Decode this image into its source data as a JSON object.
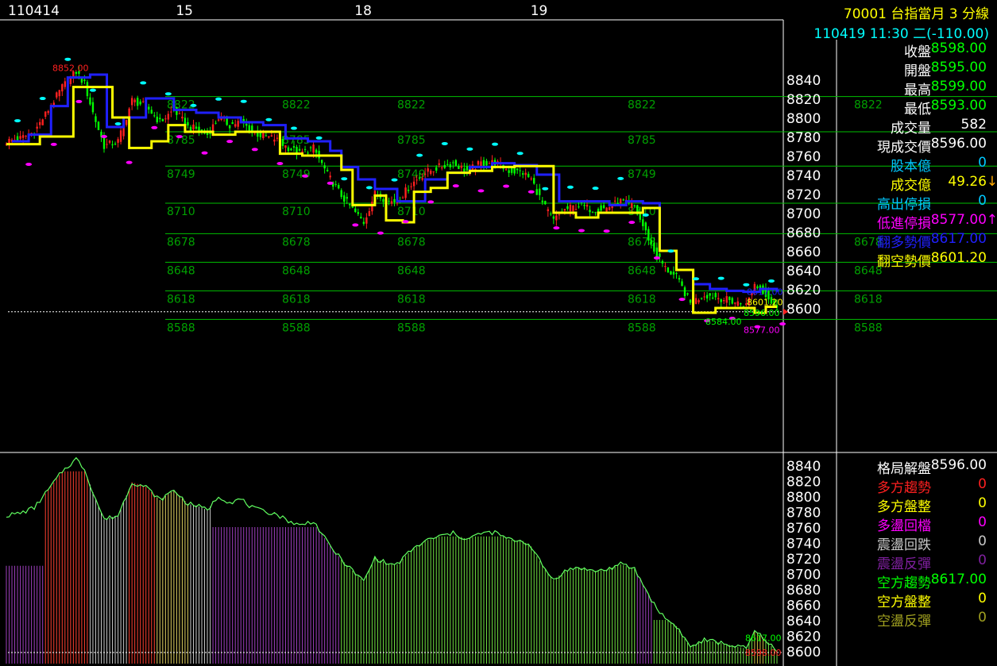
{
  "header": {
    "date_left": "110414",
    "day_labels": [
      "15",
      "18",
      "19"
    ],
    "title": "70001  台指當月 3 分線",
    "subtitle": "110419 11:30 二(-110.00)"
  },
  "quote_panel": [
    {
      "key": "close",
      "label": "收盤",
      "value": "8598.00",
      "label_color": "#ffffff",
      "value_color": "#00ff00"
    },
    {
      "key": "open",
      "label": "開盤",
      "value": "8595.00",
      "label_color": "#ffffff",
      "value_color": "#00ff00"
    },
    {
      "key": "high",
      "label": "最高",
      "value": "8599.00",
      "label_color": "#ffffff",
      "value_color": "#00ff00"
    },
    {
      "key": "low",
      "label": "最低",
      "value": "8593.00",
      "label_color": "#ffffff",
      "value_color": "#00ff00"
    },
    {
      "key": "volume",
      "label": "成交量",
      "value": "582",
      "label_color": "#ffffff",
      "value_color": "#ffffff"
    },
    {
      "key": "last",
      "label": "現成交價",
      "value": "8596.00",
      "label_color": "#ffffff",
      "value_color": "#ffffff"
    },
    {
      "key": "capital",
      "label": "股本億",
      "value": "0",
      "label_color": "#00c8ff",
      "value_color": "#00c8ff"
    },
    {
      "key": "turnover",
      "label": "成交億",
      "value": "49.26",
      "label_color": "#ffff00",
      "value_color": "#ffff00",
      "arrow": "↓",
      "arrow_color": "#ffaa00"
    },
    {
      "key": "high_stop",
      "label": "高出停損",
      "value": "0",
      "label_color": "#00c8ff",
      "value_color": "#00c8ff"
    },
    {
      "key": "low_stop",
      "label": "低進停損",
      "value": "8577.00",
      "label_color": "#ff00ff",
      "value_color": "#ff00ff",
      "arrow": "↑",
      "arrow_color": "#ff00ff"
    },
    {
      "key": "bull_price",
      "label": "翻多勢價",
      "value": "8617.00",
      "label_color": "#2020ff",
      "value_color": "#2020ff"
    },
    {
      "key": "bear_price",
      "label": "翻空勢價",
      "value": "8601.20",
      "label_color": "#ffff00",
      "value_color": "#ffff00"
    }
  ],
  "pattern_panel": [
    {
      "key": "solution",
      "label": "格局解盤",
      "value": "8596.00",
      "label_color": "#ffffff",
      "value_color": "#ffffff"
    },
    {
      "key": "bull_trend",
      "label": "多方趨勢",
      "value": "0",
      "label_color": "#ff2020",
      "value_color": "#ff2020"
    },
    {
      "key": "bull_range",
      "label": "多方盤整",
      "value": "0",
      "label_color": "#ffff00",
      "value_color": "#ffff00"
    },
    {
      "key": "bull_pull",
      "label": "多盪回檔",
      "value": "0",
      "label_color": "#ff00ff",
      "value_color": "#ff00ff"
    },
    {
      "key": "osc_fall",
      "label": "震盪回跌",
      "value": "0",
      "label_color": "#c8c8c8",
      "value_color": "#c8c8c8"
    },
    {
      "key": "osc_rebound",
      "label": "震盪反彈",
      "value": "0",
      "label_color": "#8020a0",
      "value_color": "#8020a0"
    },
    {
      "key": "bear_trend",
      "label": "空方趨勢",
      "value": "8617.00",
      "label_color": "#00ff00",
      "value_color": "#00ff00"
    },
    {
      "key": "bear_range",
      "label": "空方盤整",
      "value": "0",
      "label_color": "#ffff00",
      "value_color": "#ffff00"
    },
    {
      "key": "bear_rebound",
      "label": "空盪反彈",
      "value": "0",
      "label_color": "#a0a020",
      "value_color": "#a0a020"
    }
  ],
  "chart_data": [
    {
      "type": "candlestick",
      "name": "main",
      "y_ticks": [
        8840,
        8820,
        8800,
        8780,
        8760,
        8740,
        8720,
        8700,
        8680,
        8660,
        8640,
        8620,
        8600
      ],
      "ylim": [
        8560,
        8868
      ],
      "x_breaks": [
        "15",
        "18",
        "19"
      ],
      "levels": [
        {
          "value": 8822,
          "label": "8822"
        },
        {
          "value": 8785,
          "label": "8785"
        },
        {
          "value": 8749,
          "label": "8749"
        },
        {
          "value": 8710,
          "label": "8710"
        },
        {
          "value": 8678,
          "label": "8678"
        },
        {
          "value": 8648,
          "label": "8648"
        },
        {
          "value": 8618,
          "label": "8618"
        },
        {
          "value": 8588,
          "label": "8588"
        }
      ],
      "close_price_line": 8596,
      "annotations": [
        {
          "value": 8852,
          "label": "8852.00",
          "color": "#ff2020"
        },
        {
          "value": 8617,
          "label": "8617.00",
          "color": "#2020ff"
        },
        {
          "value": 8601.2,
          "label": "8601.20",
          "color": "#ffff00"
        },
        {
          "value": 8596,
          "label": "8596.00",
          "color": "#00ff00"
        },
        {
          "value": 8584,
          "label": "8584.00",
          "color": "#00ff00"
        },
        {
          "value": 8577,
          "label": "8577.00",
          "color": "#ff00ff"
        }
      ],
      "close_path": [
        [
          0,
          8775
        ],
        [
          5,
          8778
        ],
        [
          10,
          8785
        ],
        [
          15,
          8808
        ],
        [
          20,
          8832
        ],
        [
          25,
          8848
        ],
        [
          28,
          8835
        ],
        [
          31,
          8805
        ],
        [
          35,
          8770
        ],
        [
          40,
          8775
        ],
        [
          45,
          8818
        ],
        [
          50,
          8812
        ],
        [
          55,
          8795
        ],
        [
          60,
          8808
        ],
        [
          65,
          8790
        ],
        [
          68,
          8788
        ],
        [
          72,
          8782
        ],
        [
          76,
          8800
        ],
        [
          80,
          8792
        ],
        [
          84,
          8796
        ],
        [
          88,
          8785
        ],
        [
          92,
          8780
        ],
        [
          96,
          8778
        ],
        [
          100,
          8770
        ],
        [
          105,
          8762
        ],
        [
          110,
          8768
        ],
        [
          115,
          8740
        ],
        [
          120,
          8718
        ],
        [
          125,
          8700
        ],
        [
          128,
          8690
        ],
        [
          132,
          8720
        ],
        [
          137,
          8712
        ],
        [
          140,
          8712
        ],
        [
          145,
          8730
        ],
        [
          150,
          8742
        ],
        [
          155,
          8748
        ],
        [
          160,
          8752
        ],
        [
          165,
          8744
        ],
        [
          170,
          8752
        ],
        [
          175,
          8753
        ],
        [
          180,
          8744
        ],
        [
          185,
          8742
        ],
        [
          188,
          8735
        ],
        [
          192,
          8710
        ],
        [
          196,
          8692
        ],
        [
          200,
          8703
        ],
        [
          205,
          8708
        ],
        [
          210,
          8703
        ],
        [
          215,
          8705
        ],
        [
          220,
          8712
        ],
        [
          225,
          8706
        ],
        [
          228,
          8686
        ],
        [
          232,
          8660
        ],
        [
          236,
          8642
        ],
        [
          240,
          8632
        ],
        [
          245,
          8605
        ],
        [
          250,
          8614
        ],
        [
          255,
          8611
        ],
        [
          260,
          8607
        ],
        [
          265,
          8603
        ],
        [
          268,
          8625
        ],
        [
          272,
          8615
        ],
        [
          276,
          8598
        ]
      ],
      "blue_line": [
        [
          2,
          8775
        ],
        [
          8,
          8782
        ],
        [
          16,
          8812
        ],
        [
          22,
          8842
        ],
        [
          30,
          8845
        ],
        [
          36,
          8790
        ],
        [
          42,
          8800
        ],
        [
          50,
          8820
        ],
        [
          60,
          8808
        ],
        [
          68,
          8805
        ],
        [
          76,
          8800
        ],
        [
          84,
          8795
        ],
        [
          92,
          8792
        ],
        [
          100,
          8778
        ],
        [
          108,
          8775
        ],
        [
          116,
          8765
        ],
        [
          120,
          8748
        ],
        [
          126,
          8735
        ],
        [
          132,
          8725
        ],
        [
          140,
          8712
        ],
        [
          150,
          8735
        ],
        [
          158,
          8742
        ],
        [
          166,
          8748
        ],
        [
          174,
          8752
        ],
        [
          182,
          8750
        ],
        [
          190,
          8740
        ],
        [
          198,
          8712
        ],
        [
          208,
          8712
        ],
        [
          216,
          8708
        ],
        [
          222,
          8712
        ],
        [
          228,
          8710
        ],
        [
          234,
          8660
        ],
        [
          240,
          8640
        ],
        [
          246,
          8625
        ],
        [
          252,
          8620
        ],
        [
          258,
          8618
        ],
        [
          264,
          8617
        ],
        [
          270,
          8620
        ],
        [
          276,
          8617
        ]
      ],
      "yellow_line": [
        [
          0,
          8772
        ],
        [
          12,
          8780
        ],
        [
          24,
          8832
        ],
        [
          36,
          8832
        ],
        [
          38,
          8800
        ],
        [
          44,
          8768
        ],
        [
          52,
          8775
        ],
        [
          58,
          8792
        ],
        [
          64,
          8785
        ],
        [
          74,
          8782
        ],
        [
          82,
          8785
        ],
        [
          90,
          8785
        ],
        [
          98,
          8762
        ],
        [
          106,
          8760
        ],
        [
          116,
          8760
        ],
        [
          120,
          8745
        ],
        [
          124,
          8708
        ],
        [
          132,
          8718
        ],
        [
          136,
          8692
        ],
        [
          142,
          8690
        ],
        [
          146,
          8722
        ],
        [
          152,
          8726
        ],
        [
          158,
          8742
        ],
        [
          166,
          8744
        ],
        [
          174,
          8748
        ],
        [
          182,
          8749
        ],
        [
          190,
          8749
        ],
        [
          196,
          8700
        ],
        [
          204,
          8695
        ],
        [
          212,
          8700
        ],
        [
          220,
          8700
        ],
        [
          228,
          8705
        ],
        [
          234,
          8660
        ],
        [
          240,
          8640
        ],
        [
          246,
          8595
        ],
        [
          254,
          8600
        ],
        [
          262,
          8600
        ],
        [
          268,
          8595
        ],
        [
          272,
          8601.2
        ],
        [
          276,
          8601.2
        ]
      ]
    },
    {
      "type": "bar",
      "name": "pattern",
      "y_ticks": [
        8840,
        8820,
        8800,
        8780,
        8760,
        8740,
        8720,
        8700,
        8680,
        8660,
        8640,
        8620,
        8600
      ],
      "ylim": [
        8588,
        8848
      ],
      "annotations": [
        {
          "value": 8617,
          "label": "8617.00",
          "color": "#00ff00"
        },
        {
          "value": 8598,
          "label": "8598.00",
          "color": "#ff2020"
        }
      ],
      "segments": [
        {
          "from": 0,
          "to": 14,
          "state": "osc_rebound",
          "level": 8710
        },
        {
          "from": 14,
          "to": 30,
          "state": "bull_trend",
          "level": 8832
        },
        {
          "from": 30,
          "to": 44,
          "state": "osc_fall",
          "level": 8820
        },
        {
          "from": 44,
          "to": 54,
          "state": "bull_trend",
          "level": 8832
        },
        {
          "from": 54,
          "to": 66,
          "state": "bull_range",
          "level": 8818
        },
        {
          "from": 66,
          "to": 74,
          "state": "osc_fall",
          "level": 8812
        },
        {
          "from": 74,
          "to": 120,
          "state": "osc_rebound",
          "level": 8760
        },
        {
          "from": 120,
          "to": 148,
          "state": "bear_trend",
          "level": 8752
        },
        {
          "from": 148,
          "to": 196,
          "state": "bear_trend",
          "level": 8748
        },
        {
          "from": 196,
          "to": 226,
          "state": "bear_trend",
          "level": 8738
        },
        {
          "from": 226,
          "to": 232,
          "state": "osc_rebound",
          "level": 8700
        },
        {
          "from": 232,
          "to": 262,
          "state": "bear_trend",
          "level": 8640
        },
        {
          "from": 262,
          "to": 268,
          "state": "bear_trend",
          "level": 8630
        },
        {
          "from": 268,
          "to": 272,
          "state": "bear_range",
          "level": 8690
        },
        {
          "from": 272,
          "to": 277,
          "state": "bear_trend",
          "level": 8617
        }
      ]
    }
  ],
  "colors": {
    "grid": "#00c000",
    "level_text": "#00a000",
    "axis": "#ffffff",
    "up": "#ff2020",
    "down": "#00ff00",
    "blue": "#2020ff",
    "yellow": "#ffff00",
    "cyan_mark": "#00ffff",
    "magenta_mark": "#ff00ff",
    "state_colors": {
      "bull_trend": "#ff4030",
      "bull_range": "#e0d060",
      "bull_pull": "#ff00ff",
      "osc_fall": "#c8c8c8",
      "osc_rebound": "#a040c0",
      "bear_trend": "#70e040",
      "bear_range": "#d0c040",
      "bear_rebound": "#a0a020"
    }
  }
}
